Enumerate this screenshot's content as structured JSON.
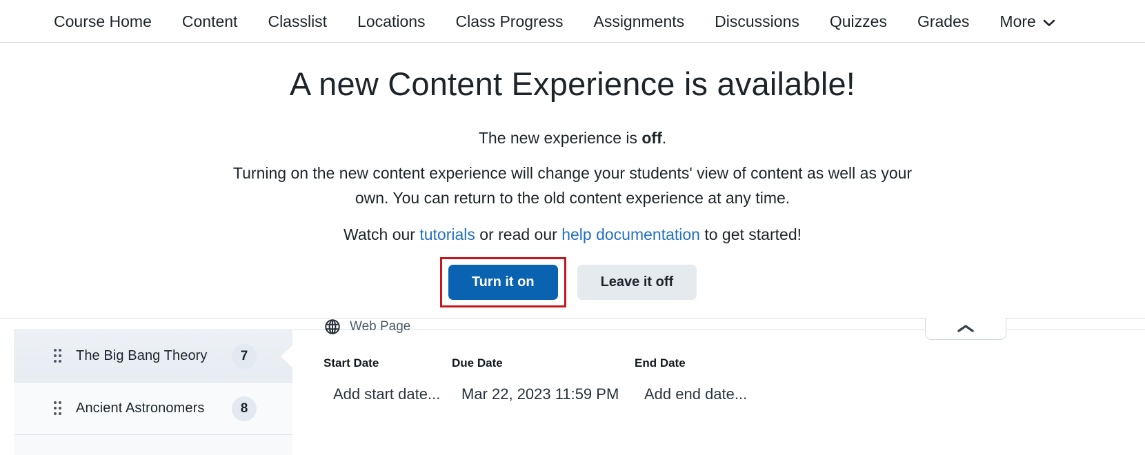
{
  "nav": {
    "items": [
      {
        "label": "Course Home",
        "name": "nav-course-home"
      },
      {
        "label": "Content",
        "name": "nav-content"
      },
      {
        "label": "Classlist",
        "name": "nav-classlist"
      },
      {
        "label": "Locations",
        "name": "nav-locations"
      },
      {
        "label": "Class Progress",
        "name": "nav-class-progress"
      },
      {
        "label": "Assignments",
        "name": "nav-assignments"
      },
      {
        "label": "Discussions",
        "name": "nav-discussions"
      },
      {
        "label": "Quizzes",
        "name": "nav-quizzes"
      },
      {
        "label": "Grades",
        "name": "nav-grades"
      }
    ],
    "more_label": "More",
    "more_icon": "chevron-down-icon"
  },
  "overlay": {
    "title": "A new Content Experience is available!",
    "status_prefix": "The new experience is ",
    "status_state": "off",
    "status_suffix": ".",
    "paragraph": "Turning on the new content experience will change your students' view of content as well as your own. You can return to the old content experience at any time.",
    "links_prefix": "Watch our ",
    "link_tutorials": "tutorials",
    "links_middle": " or read our ",
    "link_help": "help documentation",
    "links_suffix": " to get started!",
    "primary_button": "Turn it on",
    "secondary_button": "Leave it off",
    "accent_color": "#0a63b0",
    "link_color": "#1f6fc4",
    "annotation_color": "#c4161c"
  },
  "sidebar": {
    "items": [
      {
        "label": "The Big Bang Theory",
        "count": "7",
        "selected": true
      },
      {
        "label": "Ancient Astronomers",
        "count": "8",
        "selected": false
      }
    ]
  },
  "main": {
    "item_type_icon": "globe-icon",
    "item_type_label": "Web Page",
    "date_headers": [
      "Start Date",
      "Due Date",
      "End Date"
    ],
    "date_values": [
      "Add start date...",
      "Mar 22, 2023 11:59 PM",
      "Add end date..."
    ],
    "collapse_icon": "chevron-up-icon"
  }
}
